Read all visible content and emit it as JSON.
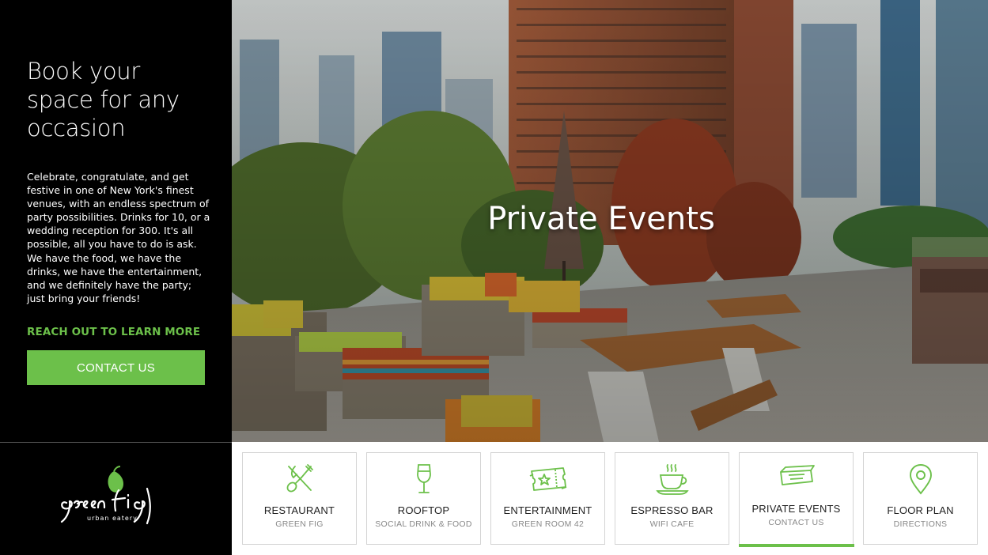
{
  "intro": {
    "headline": "Book your space for any occasion",
    "body": "Celebrate, congratulate, and get festive in one of New York's finest venues, with an endless spectrum of party possibilities. Drinks for 10, or a wedding reception for 300. It's all possible, all you have to do is ask. We have the food, we have the drinks, we have the entertainment, and we definitely have the party; just bring your friends!",
    "reach_link": "REACH OUT TO LEARN MORE",
    "contact_button": "CONTACT US"
  },
  "hero": {
    "title": "Private Events"
  },
  "logo": {
    "name": "green fig",
    "tagline": "urban eatery"
  },
  "nav": [
    {
      "title": "RESTAURANT",
      "sub": "GREEN FIG",
      "icon": "utensils-icon",
      "active": false
    },
    {
      "title": "ROOFTOP",
      "sub": "SOCIAL DRINK & FOOD",
      "icon": "wine-glass-icon",
      "active": false
    },
    {
      "title": "ENTERTAINMENT",
      "sub": "GREEN ROOM 42",
      "icon": "ticket-icon",
      "active": false
    },
    {
      "title": "ESPRESSO BAR",
      "sub": "WIFI CAFE",
      "icon": "coffee-cup-icon",
      "active": false
    },
    {
      "title": "PRIVATE EVENTS",
      "sub": "CONTACT US",
      "icon": "envelope-icon",
      "active": true
    },
    {
      "title": "FLOOR PLAN",
      "sub": "DIRECTIONS",
      "icon": "map-pin-icon",
      "active": false
    }
  ],
  "colors": {
    "accent": "#6cc04a",
    "background": "#000000"
  }
}
